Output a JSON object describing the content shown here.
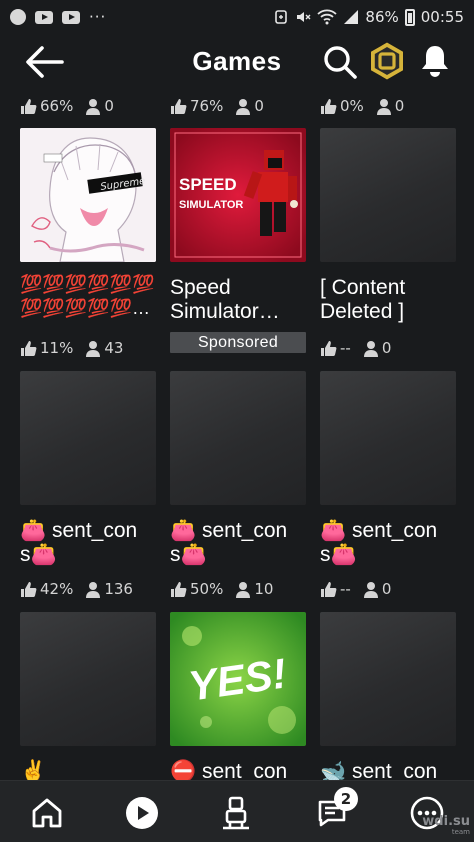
{
  "status_bar": {
    "signal": "86%",
    "time": "00:55",
    "dots": "···"
  },
  "header": {
    "title": "Games"
  },
  "rows": [
    {
      "stats": [
        {
          "rating": "66%",
          "players": "0"
        },
        {
          "rating": "76%",
          "players": "0"
        },
        {
          "rating": "0%",
          "players": "0"
        }
      ]
    },
    {
      "games": [
        {
          "name": "💯💯💯💯💯💯\n💯💯💯💯💯…",
          "rating": "11%",
          "players": "43",
          "sponsored": ""
        },
        {
          "name": "Speed\nSimulator…",
          "rating": "",
          "players": "",
          "sponsored": "Sponsored"
        },
        {
          "name": "[ Content\nDeleted ]",
          "rating": "--",
          "players": "0",
          "sponsored": ""
        }
      ]
    },
    {
      "games": [
        {
          "name": "👛 sent_con\ns👛",
          "rating": "42%",
          "players": "136"
        },
        {
          "name": "👛 sent_con\ns👛",
          "rating": "50%",
          "players": "10"
        },
        {
          "name": "👛 sent_con\ns👛",
          "rating": "--",
          "players": "0"
        }
      ]
    },
    {
      "games": [
        {
          "name": "✌"
        },
        {
          "name": "⛔ sent_con"
        },
        {
          "name": "🐋 sent_con"
        }
      ]
    }
  ],
  "thumbnails": {
    "supreme_text": "Supreme",
    "speed_text_1": "SPEED",
    "speed_text_2": "SIMULATOR",
    "yes_text": "YES!"
  },
  "nav": {
    "notifications_badge": "2"
  },
  "watermark": {
    "main": "wdi.su",
    "sub": "team"
  },
  "colors": {
    "background": "#191b1d",
    "nav": "#232527",
    "sponsored": "#4b4d50",
    "yes_green": "#3fae2a",
    "speed_red": "#c8102e"
  }
}
